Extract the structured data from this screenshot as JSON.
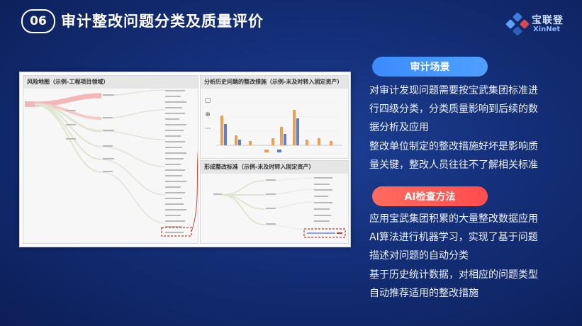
{
  "header": {
    "number": "06",
    "title": "审计整改问题分类及质量评价",
    "logo_cn": "宝联登",
    "logo_en": "XinNet"
  },
  "panels": {
    "risk_map_title": "风险地图（示例-工程项目领域）",
    "history_title": "分析历史问题的整改措施（示例-未及时转入固定资产）",
    "standard_title": "形成整改标准（示例-未及时转入固定资产）"
  },
  "scenario": {
    "label": "审计场景",
    "lines1": [
      "对审计发现问题需要按宝武集团标准进",
      "行四级分类，分类质量影响到后续的数",
      "据分析及应用"
    ],
    "lines2": [
      "整改单位制定的整改措施好坏是影响质",
      "量关键，整改人员往往不了解相关标准"
    ]
  },
  "ai": {
    "label": "AI检查方法",
    "lines1": [
      "应用宝武集团积累的大量整改数据应用",
      "AI算法进行机器学习，实现了基于问题",
      "描述对问题的自动分类"
    ],
    "lines2": [
      "基于历史统计数据，对相应的问题类型",
      "自动推荐适用的整改措施"
    ]
  },
  "colors": {
    "accent_blue": "#3b8bff",
    "accent_red": "#ff4e4e",
    "bar_orange": "#f0a04b",
    "bar_blue": "#5b7fd6",
    "highlight_red": "#c0392b"
  }
}
